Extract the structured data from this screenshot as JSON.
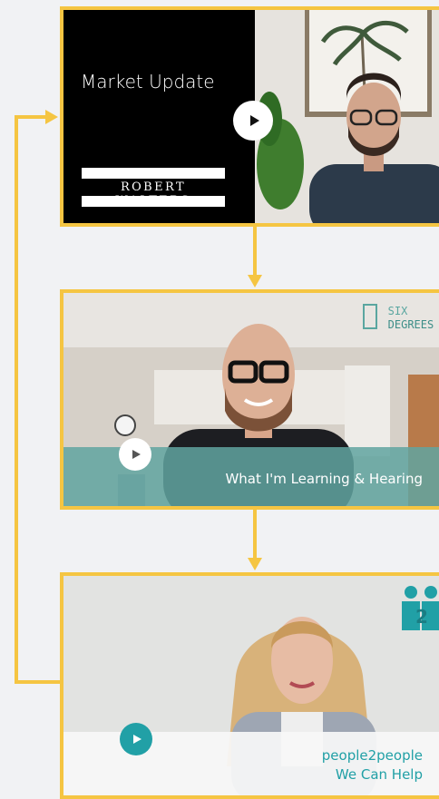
{
  "colors": {
    "background": "#f1f2f4",
    "connector": "#f5c542",
    "teal": "#21a0a6"
  },
  "cards": [
    {
      "title": "Market Update",
      "logo": "ROBERT WALTERS",
      "play_icon": "play-icon"
    },
    {
      "brand_line1": "SIX",
      "brand_line2": "DEGREES",
      "caption": "What I'm Learning & Hearing",
      "play_icon": "play-icon"
    },
    {
      "brand_line1": "people2people",
      "brand_line2": "We Can Help",
      "play_icon": "play-icon"
    }
  ]
}
